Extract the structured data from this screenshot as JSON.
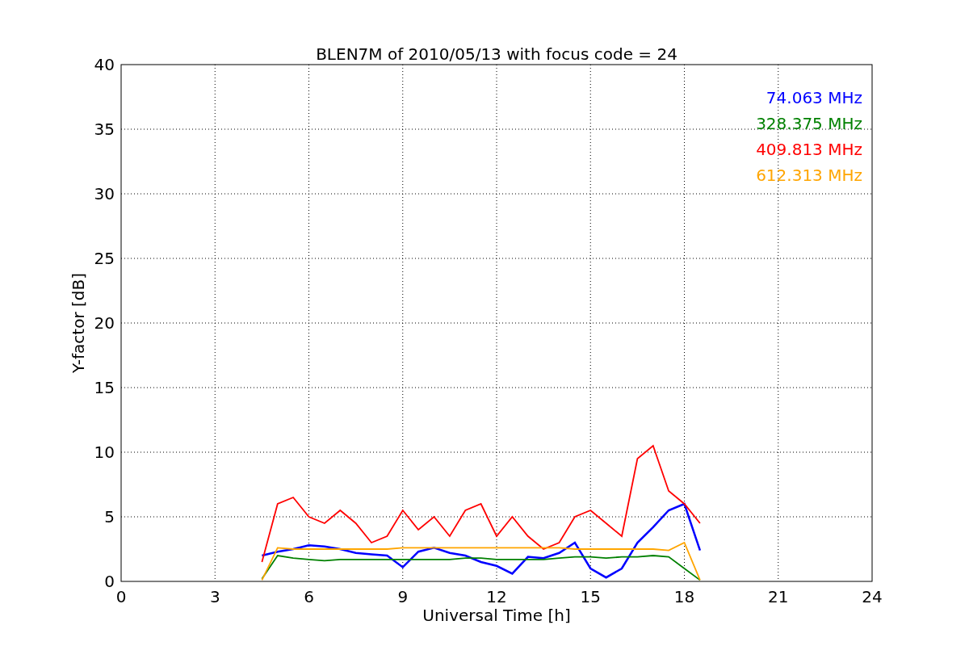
{
  "chart_data": {
    "type": "line",
    "title": "BLEN7M of 2010/05/13 with focus code = 24",
    "xlabel": "Universal Time [h]",
    "ylabel": "Y-factor [dB]",
    "x": [
      4.5,
      5,
      5.5,
      6,
      6.5,
      7,
      7.5,
      8,
      8.5,
      9,
      9.5,
      10,
      10.5,
      11,
      11.5,
      12,
      12.5,
      13,
      13.5,
      14,
      14.5,
      15,
      15.5,
      16,
      16.5,
      17,
      17.5,
      18,
      18.5
    ],
    "series": [
      {
        "name": "74.063 MHz",
        "color": "#0000ff",
        "values": [
          2.0,
          2.3,
          2.5,
          2.8,
          2.7,
          2.5,
          2.2,
          2.1,
          2.0,
          1.1,
          2.3,
          2.6,
          2.2,
          2.0,
          1.5,
          1.2,
          0.6,
          1.9,
          1.8,
          2.2,
          3.0,
          1.0,
          0.3,
          1.0,
          3.0,
          4.2,
          5.5,
          6.0,
          2.4
        ]
      },
      {
        "name": "328.375 MHz",
        "color": "#008000",
        "values": [
          0.2,
          2.0,
          1.8,
          1.7,
          1.6,
          1.7,
          1.7,
          1.7,
          1.7,
          1.7,
          1.7,
          1.7,
          1.7,
          1.8,
          1.8,
          1.7,
          1.7,
          1.7,
          1.7,
          1.8,
          1.9,
          1.9,
          1.8,
          1.9,
          1.9,
          2.0,
          1.9,
          1.0,
          0.1
        ]
      },
      {
        "name": "409.813 MHz",
        "color": "#ff0000",
        "values": [
          1.5,
          6.0,
          6.5,
          5.0,
          4.5,
          5.5,
          4.5,
          3.0,
          3.5,
          5.5,
          4.0,
          5.0,
          3.5,
          5.5,
          6.0,
          3.5,
          5.0,
          3.5,
          2.5,
          3.0,
          5.0,
          5.5,
          4.5,
          3.5,
          9.5,
          10.5,
          7.0,
          6.0,
          4.5
        ]
      },
      {
        "name": "612.313 MHz",
        "color": "#ffa500",
        "values": [
          0.1,
          2.6,
          2.5,
          2.5,
          2.5,
          2.5,
          2.5,
          2.5,
          2.5,
          2.6,
          2.6,
          2.6,
          2.6,
          2.6,
          2.6,
          2.6,
          2.6,
          2.6,
          2.6,
          2.6,
          2.5,
          2.5,
          2.5,
          2.5,
          2.5,
          2.5,
          2.4,
          3.0,
          0.1
        ]
      }
    ],
    "grid": true,
    "xlim": [
      0,
      24
    ],
    "ylim": [
      0,
      40
    ],
    "xticks": [
      0,
      3,
      6,
      9,
      12,
      15,
      18,
      21,
      24
    ],
    "yticks": [
      0,
      5,
      10,
      15,
      20,
      25,
      30,
      35,
      40
    ]
  }
}
